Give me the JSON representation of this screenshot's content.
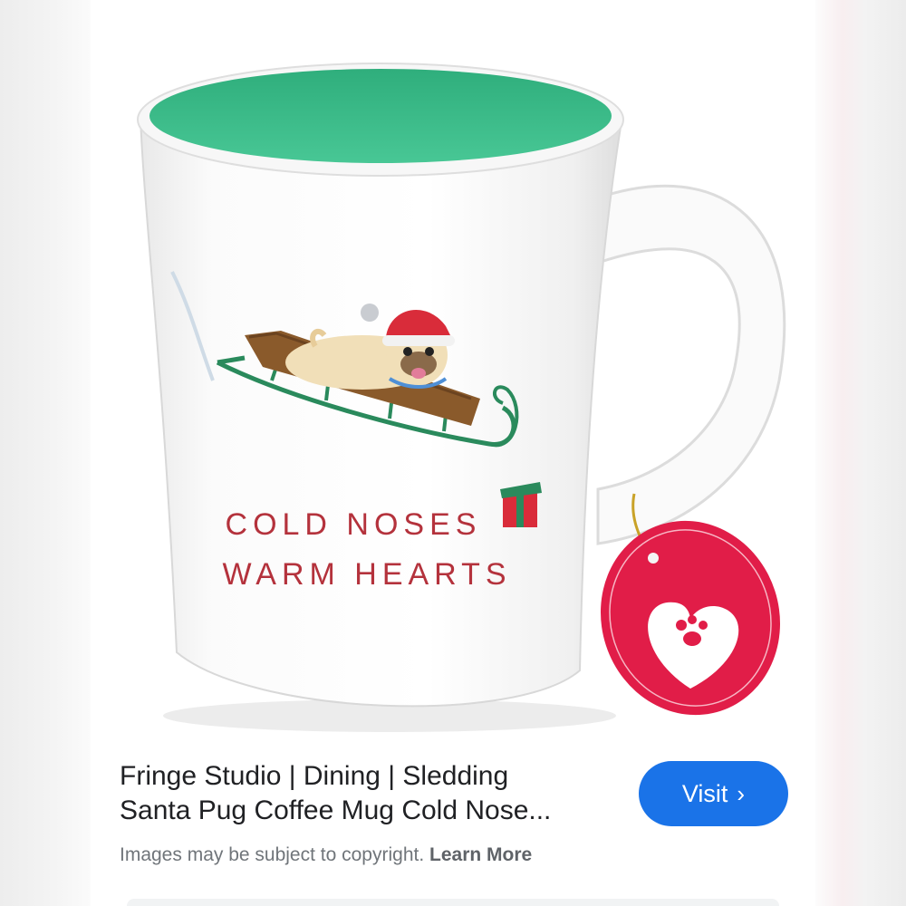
{
  "product": {
    "mug_text_line1": "COLD NOSES",
    "mug_text_line2": "WARM HEARTS",
    "title_line1": "Fringe Studio | Dining | Sledding",
    "title_line2": "Santa Pug Coffee Mug Cold Nose..."
  },
  "actions": {
    "visit_label": "Visit",
    "visit_chevron": "›"
  },
  "notice": {
    "copyright_text": "Images may be subject to copyright.",
    "learn_more_label": "Learn More"
  },
  "colors": {
    "accent": "#1a73e8",
    "mug_inner": "#3fbf8f",
    "tag_red": "#e11d48",
    "text_primary": "#202124",
    "text_secondary": "#70757a"
  }
}
